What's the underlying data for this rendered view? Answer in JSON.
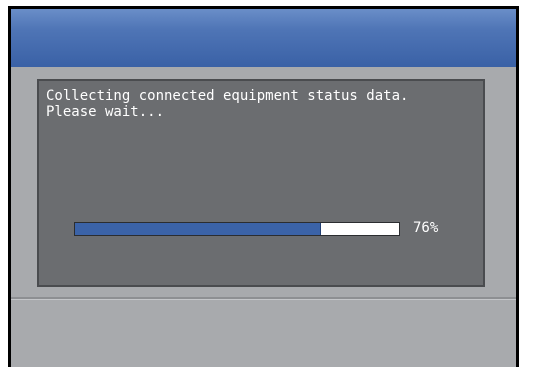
{
  "dialog": {
    "message_line1": "Collecting connected equipment status data.",
    "message_line2": "Please wait...",
    "progress": 76,
    "progress_label": "76%"
  },
  "colors": {
    "titlebar": "#4f75b6",
    "dialog_bg": "#6b6d70",
    "body_bg": "#a8aaad",
    "progress_fill": "#3b63a8",
    "progress_track": "#ffffff"
  }
}
